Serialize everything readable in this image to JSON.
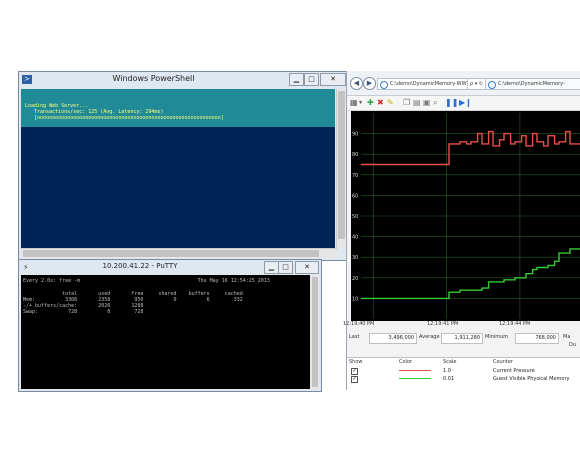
{
  "powershell": {
    "title": "Windows PowerShell",
    "progress_lines": [
      "Loading Web Server...",
      "   Transactions/sec: 125 (Avg. Latency: 294ms)",
      "   [ooooooooooooooooooooooooooooooooooooooooooooooooooooooooooooo]"
    ]
  },
  "putty": {
    "title": "10.200.41.22 - PuTTY",
    "lines": [
      "Every 2.0s: free -m                                       Thu May 16 12:54:25 2013",
      "",
      "             total       used       free     shared    buffers     cached",
      "Mem:          3308       2358        950          0          6        332",
      "-/+ buffers/cache:       2020       1288",
      "Swap:          728          0        728"
    ]
  },
  "browser": {
    "nav_back": "◀",
    "nav_forward": "▶",
    "address1": "C:\\demo\\DynamicMemory-WWW",
    "address1_controls": "ρ ▾ ↻",
    "address2": "C:\\demo\\DynamicMemory-",
    "toolbar_icons": [
      "view-icon",
      "add-icon",
      "delete-icon",
      "highlight-icon",
      "copy-icon",
      "paste-icon",
      "properties-icon",
      "zoom-icon",
      "pause-icon",
      "next-icon"
    ]
  },
  "perfmon": {
    "stats": {
      "last_label": "Last",
      "last_value": "3,496,000",
      "average_label": "Average",
      "average_value": "1,911,280",
      "minimum_label": "Minimum",
      "minimum_value": "768,000",
      "maximum_label": "Ma",
      "duration_label": "Du"
    },
    "legend": {
      "headers": [
        "Show",
        "Color",
        "Scale",
        "Counter"
      ],
      "rows": [
        {
          "show": "✓",
          "color": "#e8504a",
          "scale": "1.0",
          "counter": "Current Pressure"
        },
        {
          "show": "✓",
          "color": "#33cc33",
          "scale": "0.01",
          "counter": "Guest Visible Physical Memory"
        }
      ]
    }
  },
  "chart_data": {
    "type": "line",
    "x_ticks": [
      "12:19:40 PM",
      "12:19:41 PM",
      "12:19:44 PM"
    ],
    "y_ticks": [
      "10",
      "20",
      "30",
      "40",
      "50",
      "60",
      "70",
      "80",
      "90"
    ],
    "ylim": [
      0,
      100
    ],
    "grid": true,
    "background": "#000000",
    "series": [
      {
        "name": "Current Pressure",
        "color": "#e8504a",
        "x": [
          0,
          5,
          10,
          15,
          20,
          25,
          30,
          35,
          38,
          40,
          45,
          48,
          50,
          53,
          55,
          58,
          60,
          63,
          65,
          68,
          70,
          73,
          75,
          78,
          80,
          83,
          85,
          88,
          90,
          93,
          95,
          100
        ],
        "values": [
          75,
          75,
          75,
          75,
          75,
          75,
          75,
          75,
          75,
          85,
          86,
          85,
          86,
          90,
          85,
          91,
          84,
          87,
          90,
          85,
          86,
          89,
          84,
          90,
          86,
          84,
          89,
          85,
          86,
          91,
          85,
          86
        ]
      },
      {
        "name": "Guest Visible Physical Memory",
        "color": "#33cc33",
        "x": [
          0,
          5,
          10,
          15,
          20,
          25,
          30,
          35,
          38,
          40,
          45,
          50,
          55,
          58,
          60,
          65,
          70,
          75,
          78,
          80,
          85,
          88,
          90,
          95,
          100
        ],
        "values": [
          10,
          10,
          10,
          10,
          10,
          10,
          10,
          10,
          10,
          13,
          14,
          14,
          15,
          18,
          18,
          19,
          20,
          22,
          24,
          25,
          26,
          28,
          32,
          34,
          35
        ]
      }
    ]
  }
}
